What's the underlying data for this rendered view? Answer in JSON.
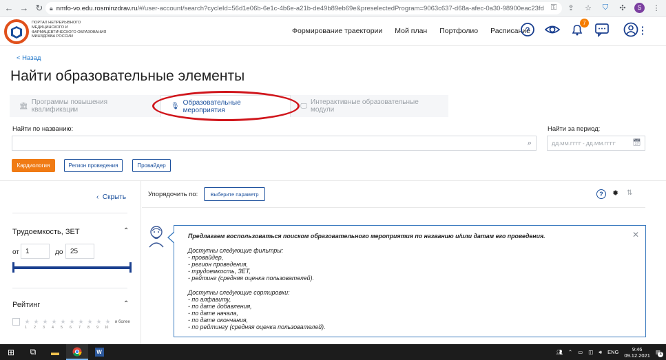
{
  "browser": {
    "url_host": "nmfo-vo.edu.rosminzdrav.ru",
    "url_path": "/#/user-account/search?cycleId=56d1e06b-6e1c-4b6e-a21b-de49b89eb69e&preselectedProgram=9063c637-d68a-afec-0a30-98900eac23fd",
    "profile_initial": "S"
  },
  "header": {
    "logo_text": "Портал непрерывного медицинского и фармацевтического образования Минздрава России",
    "nav": [
      "Формирование траектории",
      "Мой план",
      "Портфолио",
      "Расписание"
    ],
    "notification_count": "7"
  },
  "page": {
    "back_label": "< Назад",
    "title": "Найти образовательные элементы"
  },
  "tabs": [
    {
      "label": "Программы повышения квалификации",
      "icon": "building-icon"
    },
    {
      "label": "Образовательные мероприятия",
      "icon": "microphone-icon",
      "active": true
    },
    {
      "label": "Интерактивные образовательные модули",
      "icon": "monitor-icon"
    }
  ],
  "search": {
    "name_label": "Найти по названию:",
    "name_value": "",
    "period_label": "Найти за период:",
    "period_placeholder": "ДД.ММ.ГГГГ - ДД.ММ.ГГГГ"
  },
  "filters": {
    "chips": [
      "Кардиология",
      "Регион проведения",
      "Провайдер"
    ]
  },
  "sidebar": {
    "hide_label": "Скрыть",
    "labor_title": "Трудоемкость, ЗЕТ",
    "from_label": "от",
    "from_value": "1",
    "to_label": "до",
    "to_value": "25",
    "rating_title": "Рейтинг",
    "rating_numbers": [
      "1",
      "2",
      "3",
      "4",
      "5",
      "6",
      "7",
      "8",
      "9",
      "10"
    ],
    "rating_more": "и более"
  },
  "sort": {
    "label": "Упорядочить по:",
    "button": "Выберите параметр"
  },
  "info": {
    "title": "Предлагаем воспользоваться поиском образовательного мероприятия по названию и/или датам его проведения.",
    "filters_heading": "Доступны следующие фильтры:",
    "filters": [
      "- провайдер,",
      "- регион проведения,",
      "- трудоемкость, ЗЕТ,",
      "- рейтинг (средняя оценка пользователей)."
    ],
    "sorts_heading": "Доступны следующие сортировки:",
    "sorts": [
      "- по алфавиту,",
      "- по дате добавления,",
      "- по дате начала,",
      "- по дате окончания,",
      "- по рейтингу (средняя оценка пользователей)."
    ]
  },
  "taskbar": {
    "lang": "ENG",
    "time": "9:46",
    "date": "09.12.2021",
    "notifications": "3"
  }
}
